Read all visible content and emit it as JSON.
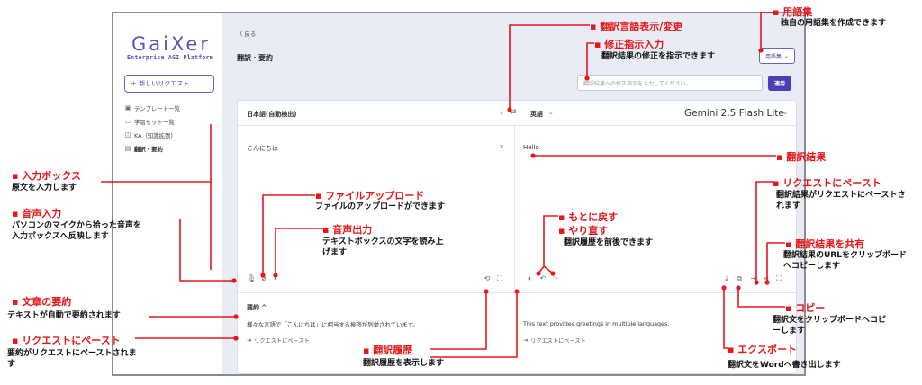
{
  "sidebar": {
    "logo": "GaiXer",
    "logo_sub": "Enterprise AGI Platform",
    "new_request": "＋ 新しいリクエスト",
    "items": [
      {
        "icon": "template-icon",
        "glyph": "▣",
        "label": "テンプレート一覧"
      },
      {
        "icon": "dataset-icon",
        "glyph": "▭",
        "label": "学習セット一覧"
      },
      {
        "icon": "knowledge-icon",
        "glyph": "◫",
        "label": "KA（知識拡張）"
      },
      {
        "icon": "translate-icon",
        "glyph": "▤",
        "label": "翻訳・要約"
      }
    ]
  },
  "header": {
    "back": "〈 戻る",
    "title": "翻訳・要約",
    "glossary_button": "用語集",
    "fix_placeholder": "翻訳結果への修正指示を入力してください。",
    "apply_button": "適用"
  },
  "translator": {
    "source_lang": "日本語(自動検出)",
    "swap": "⇄",
    "target_lang": "英語",
    "model": "Gemini 2.5 Flash Lite",
    "input_text": "こんにちは",
    "output_text": "Hello",
    "summary_label": "要約",
    "summary_source": "様々な言語で「こんにちは」に相当する挨拶が列挙されています。",
    "summary_target": "This text provides greetings in multiple languages.",
    "paste_label": "リクエストにペースト"
  },
  "annotations": {
    "glossary": {
      "title": "▪ 用語集",
      "desc": "独自の用語集を作成できます"
    },
    "lang": {
      "title": "▪ 翻訳言語表示/変更"
    },
    "fix": {
      "title": "▪ 修正指示入力",
      "desc": "翻訳結果の修正を指示できます"
    },
    "result": {
      "title": "▪ 翻訳結果"
    },
    "paste_req_right": {
      "title": "▪ リクエストにペースト",
      "desc": "翻訳結果がリクエストにペーストされます"
    },
    "share": {
      "title": "▪ 翻訳結果を共有",
      "desc": "翻訳結果のURLをクリップボードへコピーします"
    },
    "copy": {
      "title": "▪ コピー",
      "desc": "翻訳文をクリップボードへコピーします"
    },
    "export": {
      "title": "▪ エクスポート",
      "desc": "翻訳文をWordへ書き出します"
    },
    "history": {
      "title": "▪ 翻訳履歴",
      "desc": "翻訳履歴を表示します"
    },
    "undo": {
      "title": "▪ もとに戻す"
    },
    "redo": {
      "title": "▪ やり直す",
      "desc": "翻訳履歴を前後できます"
    },
    "input_box": {
      "title": "▪ 入力ボックス",
      "desc": "原文を入力します"
    },
    "voice_in": {
      "title": "▪ 音声入力",
      "desc": "パソコンのマイクから拾った音声を入力ボックスへ反映します"
    },
    "upload": {
      "title": "▪ ファイルアップロード",
      "desc": "ファイルのアップロードができます"
    },
    "voice_out": {
      "title": "▪ 音声出力",
      "desc": "テキストボックスの文字を読み上げます"
    },
    "summary": {
      "title": "▪ 文章の要約",
      "desc": "テキストが自動で要約されます"
    },
    "paste_req_left": {
      "title": "▪ リクエストにペースト",
      "desc": "要約がリクエストにペーストされます"
    }
  },
  "colors": {
    "accent": "#4a3fb4",
    "annotation": "#e8161a",
    "main_bg": "#e9ecf5"
  }
}
